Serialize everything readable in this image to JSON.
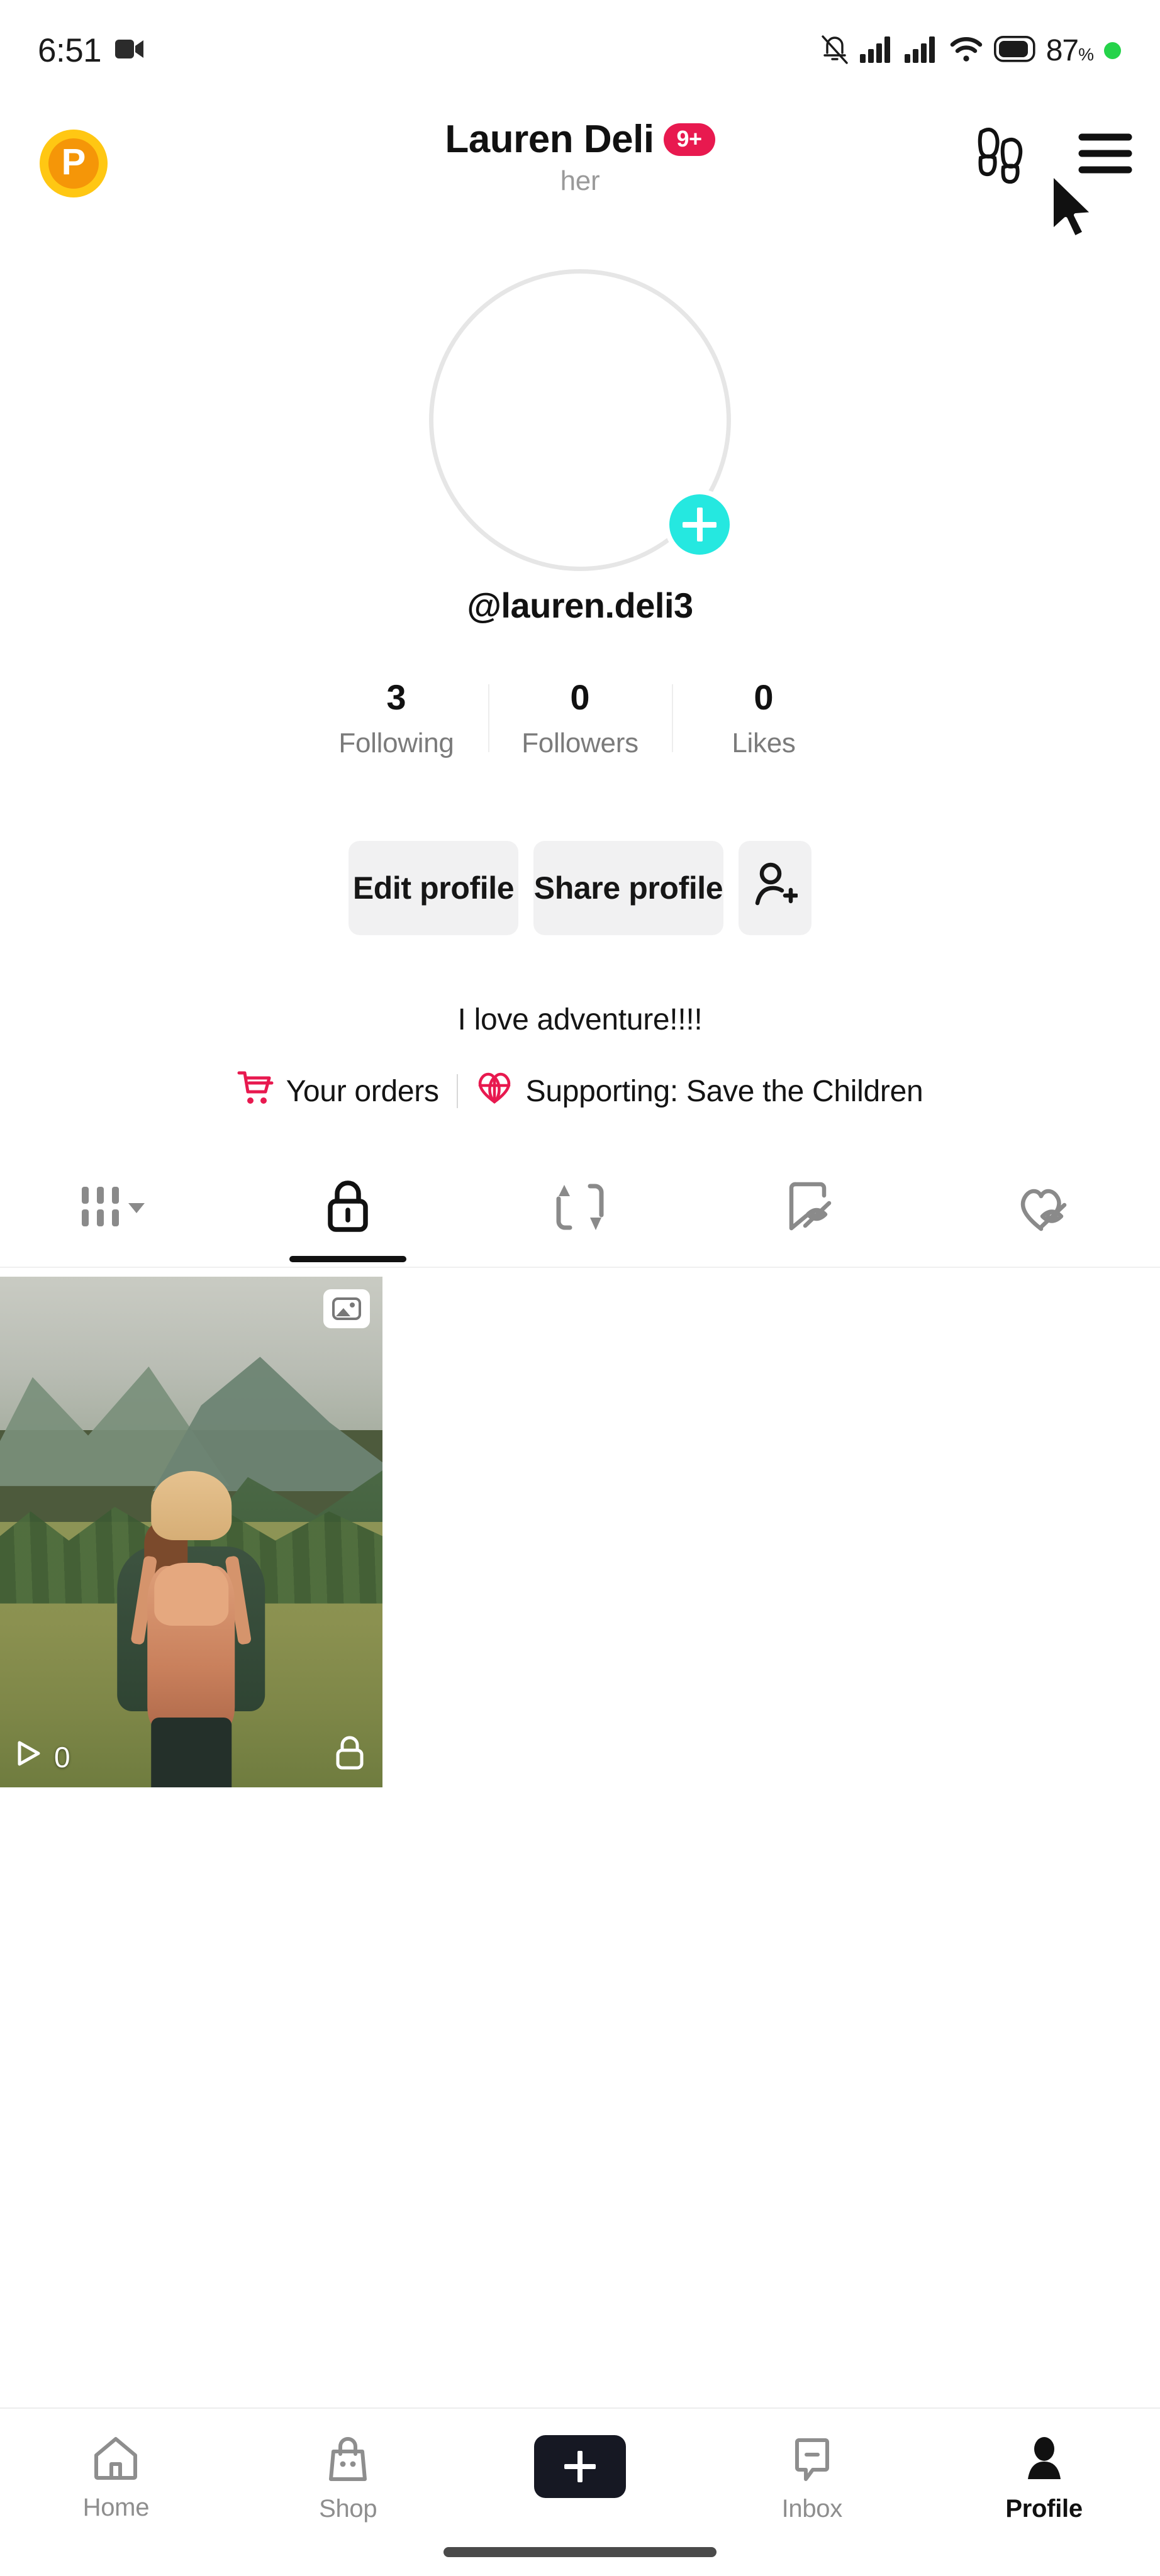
{
  "status_bar": {
    "time": "6:51",
    "battery_percent": "87",
    "percent_symbol": "%",
    "icons": [
      "video-camera-icon",
      "mute-vibrate-icon",
      "signal-bars-1-icon",
      "signal-bars-2-icon",
      "wifi-icon",
      "battery-icon",
      "recording-dot-icon"
    ]
  },
  "header": {
    "coin_letter": "P",
    "display_name": "Lauren Deli",
    "notification_badge": "9+",
    "pronoun": "her",
    "footprints_icon": "footprints-icon",
    "menu_icon": "hamburger-menu-icon",
    "badge_color": "#E8194F",
    "coin_outer_color": "#FFC713",
    "coin_inner_color": "#F59608"
  },
  "profile": {
    "handle": "@lauren.deli3",
    "avatar_alt": "woman with backpack hiking in forest",
    "add_story_icon": "plus-icon",
    "add_story_color": "#25E8E0",
    "bio": "I love adventure!!!!"
  },
  "stats": [
    {
      "count": "3",
      "label": "Following"
    },
    {
      "count": "0",
      "label": "Followers"
    },
    {
      "count": "0",
      "label": "Likes"
    }
  ],
  "actions": {
    "edit_profile": "Edit profile",
    "share_profile": "Share profile",
    "add_friends_icon": "add-person-icon"
  },
  "links": {
    "orders_label": "Your orders",
    "orders_icon": "shopping-cart-icon",
    "supporting_label": "Supporting: Save the Children",
    "supporting_icon": "heart-globe-icon",
    "accent_color": "#E8194F"
  },
  "tabs": [
    {
      "name": "videos-grid",
      "icon": "grid-bars-dropdown-icon",
      "active": false
    },
    {
      "name": "private",
      "icon": "lock-icon",
      "active": true
    },
    {
      "name": "reposts",
      "icon": "repost-arrows-icon",
      "active": false
    },
    {
      "name": "private-saved",
      "icon": "bookmark-hidden-icon",
      "active": false
    },
    {
      "name": "private-liked",
      "icon": "heart-hidden-icon",
      "active": false
    }
  ],
  "videos": [
    {
      "play_count": "0",
      "play_icon": "play-triangle-icon",
      "privacy_icon": "lock-icon",
      "type_badge": "photo-image-icon",
      "alt": "person in beanie with orange backpack in mountain meadow"
    }
  ],
  "bottom_nav": {
    "items": [
      {
        "label": "Home",
        "icon": "home-icon",
        "active": false
      },
      {
        "label": "Shop",
        "icon": "shop-bag-icon",
        "active": false
      },
      {
        "label": "",
        "icon": "create-plus-icon",
        "active": false
      },
      {
        "label": "Inbox",
        "icon": "inbox-message-icon",
        "active": false
      },
      {
        "label": "Profile",
        "icon": "person-icon",
        "active": true
      }
    ],
    "create_left_color": "#28E7E3",
    "create_right_color": "#F5255F",
    "create_bg_color": "#161823"
  }
}
